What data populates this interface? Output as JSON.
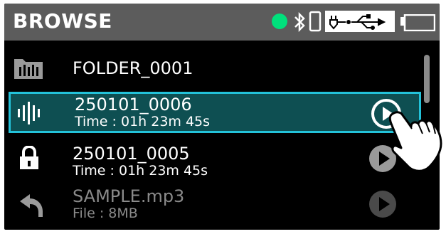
{
  "header": {
    "title": "BROWSE",
    "status_dot_color": "#00e07c",
    "icons": [
      "status-dot",
      "bluetooth-icon",
      "phone-icon",
      "usb-icon",
      "battery-icon"
    ]
  },
  "list": {
    "items": [
      {
        "type": "folder",
        "icon": "folder-icon",
        "name": "FOLDER_0001"
      },
      {
        "type": "audio",
        "icon": "waveform-icon",
        "name": "250101_0006",
        "detail": "Time : 01h 23m 45s",
        "selected": true
      },
      {
        "type": "locked",
        "icon": "lock-icon",
        "name": "250101_0005",
        "detail": "Time : 01h 23m 45s"
      },
      {
        "type": "sample",
        "icon": "undo-icon",
        "name": "SAMPLE.mp3",
        "detail": "File : 8MB"
      }
    ]
  },
  "colors": {
    "accent": "#23c2d9",
    "selected_bg": "#0e4f52",
    "header_bg": "#5c5c5c"
  }
}
